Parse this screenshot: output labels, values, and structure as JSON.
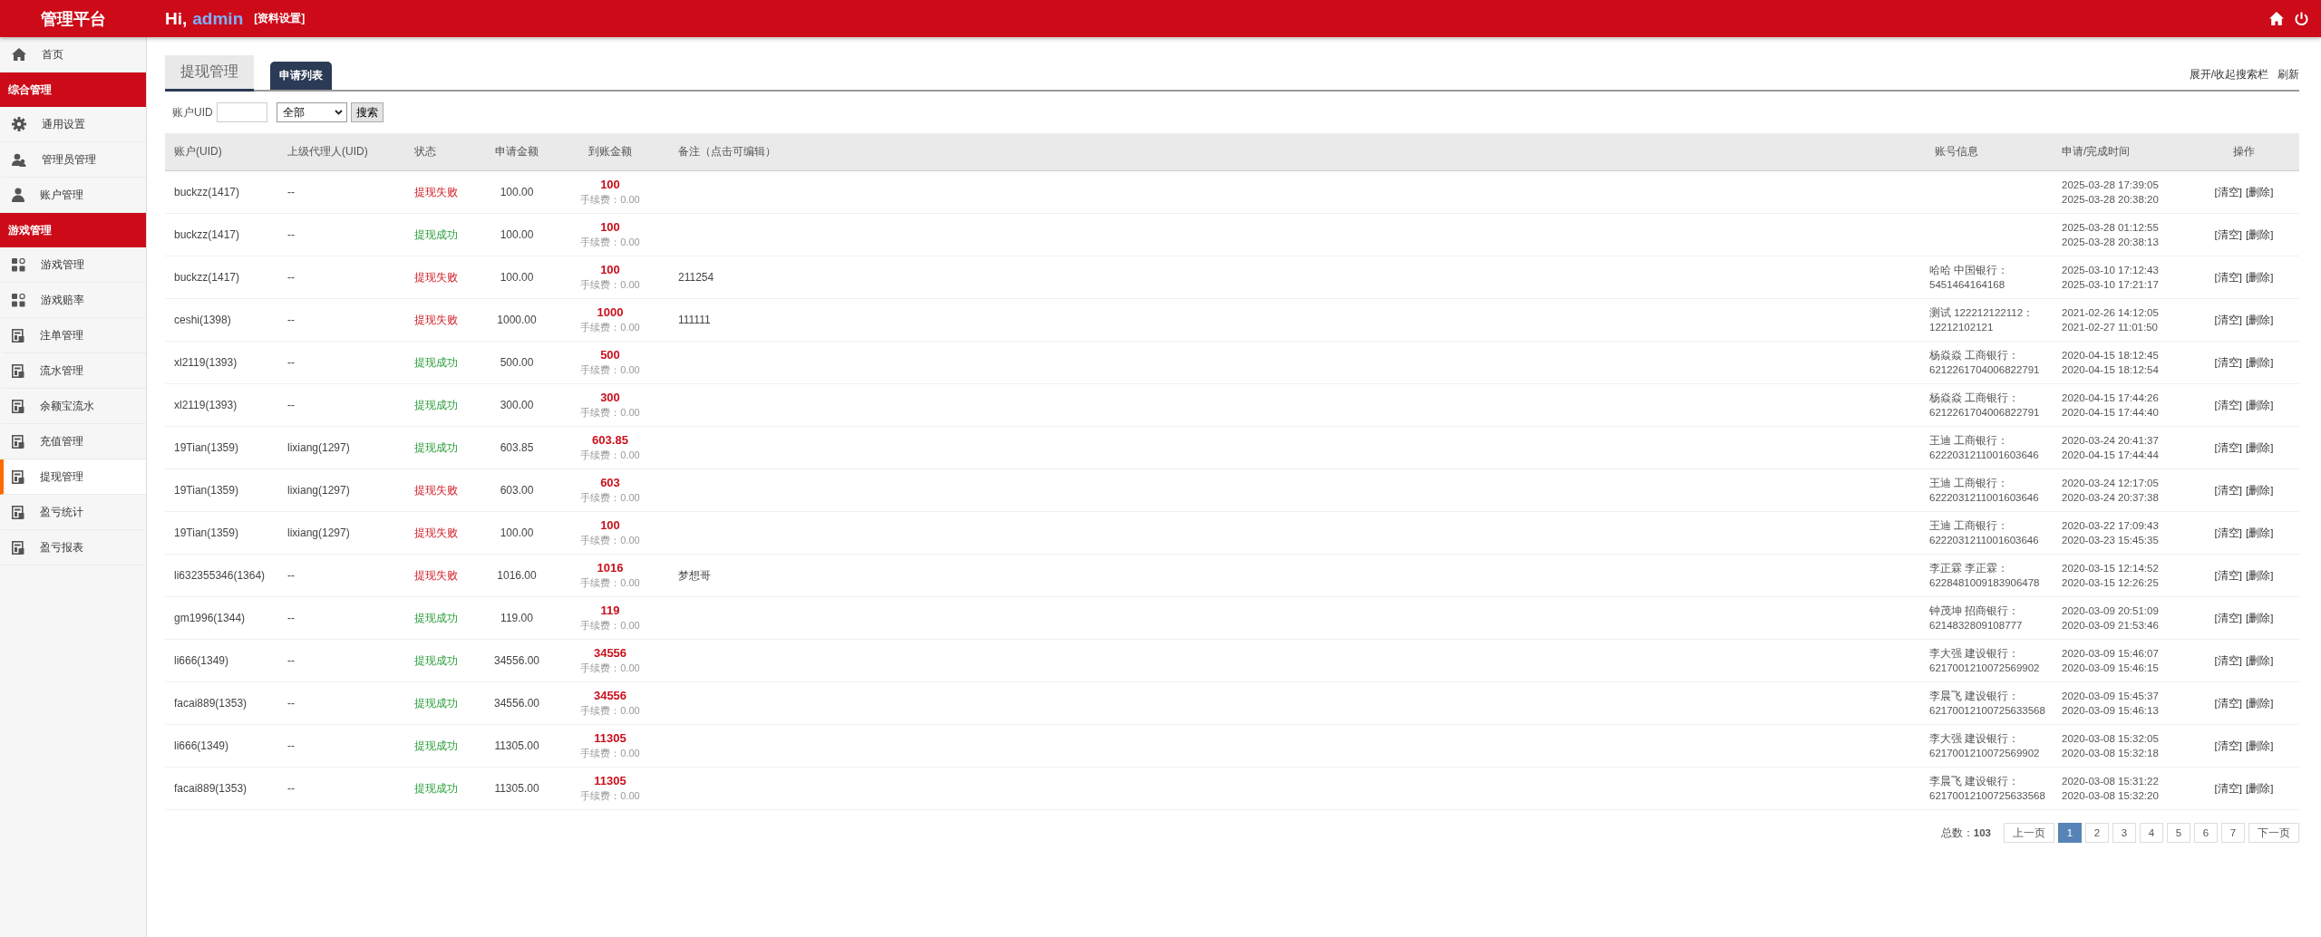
{
  "header": {
    "title": "管理平台",
    "greeting": "Hi,",
    "user": "admin",
    "profile_link": "[资料设置]"
  },
  "sidebar": {
    "items": [
      {
        "kind": "item",
        "label": "首页",
        "selected": false
      },
      {
        "kind": "section",
        "label": "综合管理",
        "selected": false
      },
      {
        "kind": "item",
        "label": "通用设置",
        "selected": false
      },
      {
        "kind": "item",
        "label": "管理员管理",
        "selected": false
      },
      {
        "kind": "item",
        "label": "账户管理",
        "selected": false
      },
      {
        "kind": "section",
        "label": "游戏管理",
        "selected": false
      },
      {
        "kind": "item",
        "label": "游戏管理",
        "selected": false
      },
      {
        "kind": "item",
        "label": "游戏赔率",
        "selected": false
      },
      {
        "kind": "item",
        "label": "注单管理",
        "selected": false
      },
      {
        "kind": "item",
        "label": "流水管理",
        "selected": false
      },
      {
        "kind": "item",
        "label": "余额宝流水",
        "selected": false
      },
      {
        "kind": "item",
        "label": "充值管理",
        "selected": false
      },
      {
        "kind": "item",
        "label": "提现管理",
        "selected": true
      },
      {
        "kind": "item",
        "label": "盈亏统计",
        "selected": false
      },
      {
        "kind": "item",
        "label": "盈亏报表",
        "selected": false
      }
    ]
  },
  "tabs": [
    {
      "label": "提现管理",
      "selected": false
    },
    {
      "label": "申请列表",
      "selected": true
    }
  ],
  "toolbar_links": [
    "展开/收起搜索栏",
    "刷新"
  ],
  "search": {
    "label": "账户UID",
    "select_value": "全部",
    "button": "搜索"
  },
  "table": {
    "columns": [
      "账户(UID)",
      "上级代理人(UID)",
      "状态",
      "申请金额",
      "到账金额",
      "备注（点击可编辑）",
      "账号信息",
      "申请/完成时间",
      "操作"
    ],
    "rows": [
      {
        "account": "buckzz(1417)",
        "agent": "--",
        "status": "提现失败",
        "succeeded": false,
        "amount": "100.00",
        "received": "100",
        "fee": "手续费：0.00",
        "note": "",
        "info": [],
        "times": [
          "2025-03-28 17:39:05",
          "2025-03-28 20:38:20"
        ],
        "actions": [
          "[清空]",
          "[删除]"
        ]
      },
      {
        "account": "buckzz(1417)",
        "agent": "--",
        "status": "提现成功",
        "succeeded": true,
        "amount": "100.00",
        "received": "100",
        "fee": "手续费：0.00",
        "note": "",
        "info": [],
        "times": [
          "2025-03-28 01:12:55",
          "2025-03-28 20:38:13"
        ],
        "actions": [
          "[清空]",
          "[删除]"
        ]
      },
      {
        "account": "buckzz(1417)",
        "agent": "--",
        "status": "提现失败",
        "succeeded": false,
        "amount": "100.00",
        "received": "100",
        "fee": "手续费：0.00",
        "note": "211254",
        "info": [
          "哈哈 中国银行：",
          "5451464164168"
        ],
        "times": [
          "2025-03-10 17:12:43",
          "2025-03-10 17:21:17"
        ],
        "actions": [
          "[清空]",
          "[删除]"
        ]
      },
      {
        "account": "ceshi(1398)",
        "agent": "--",
        "status": "提现失败",
        "succeeded": false,
        "amount": "1000.00",
        "received": "1000",
        "fee": "手续费：0.00",
        "note": "111111",
        "info": [
          "测试 122212122112：",
          "12212102121"
        ],
        "times": [
          "2021-02-26 14:12:05",
          "2021-02-27 11:01:50"
        ],
        "actions": [
          "[清空]",
          "[删除]"
        ]
      },
      {
        "account": "xl2119(1393)",
        "agent": "--",
        "status": "提现成功",
        "succeeded": true,
        "amount": "500.00",
        "received": "500",
        "fee": "手续费：0.00",
        "note": "",
        "info": [
          "杨焱焱 工商银行：",
          "6212261704006822791"
        ],
        "times": [
          "2020-04-15 18:12:45",
          "2020-04-15 18:12:54"
        ],
        "actions": [
          "[清空]",
          "[删除]"
        ]
      },
      {
        "account": "xl2119(1393)",
        "agent": "--",
        "status": "提现成功",
        "succeeded": true,
        "amount": "300.00",
        "received": "300",
        "fee": "手续费：0.00",
        "note": "",
        "info": [
          "杨焱焱 工商银行：",
          "6212261704006822791"
        ],
        "times": [
          "2020-04-15 17:44:26",
          "2020-04-15 17:44:40"
        ],
        "actions": [
          "[清空]",
          "[删除]"
        ]
      },
      {
        "account": "19Tian(1359)",
        "agent": "lixiang(1297)",
        "status": "提现成功",
        "succeeded": true,
        "amount": "603.85",
        "received": "603.85",
        "fee": "手续费：0.00",
        "note": "",
        "info": [
          "王迪 工商银行：",
          "6222031211001603646"
        ],
        "times": [
          "2020-03-24 20:41:37",
          "2020-04-15 17:44:44"
        ],
        "actions": [
          "[清空]",
          "[删除]"
        ]
      },
      {
        "account": "19Tian(1359)",
        "agent": "lixiang(1297)",
        "status": "提现失败",
        "succeeded": false,
        "amount": "603.00",
        "received": "603",
        "fee": "手续费：0.00",
        "note": "",
        "info": [
          "王迪 工商银行：",
          "6222031211001603646"
        ],
        "times": [
          "2020-03-24 12:17:05",
          "2020-03-24 20:37:38"
        ],
        "actions": [
          "[清空]",
          "[删除]"
        ]
      },
      {
        "account": "19Tian(1359)",
        "agent": "lixiang(1297)",
        "status": "提现失败",
        "succeeded": false,
        "amount": "100.00",
        "received": "100",
        "fee": "手续费：0.00",
        "note": "",
        "info": [
          "王迪 工商银行：",
          "6222031211001603646"
        ],
        "times": [
          "2020-03-22 17:09:43",
          "2020-03-23 15:45:35"
        ],
        "actions": [
          "[清空]",
          "[删除]"
        ]
      },
      {
        "account": "li632355346(1364)",
        "agent": "--",
        "status": "提现失败",
        "succeeded": false,
        "amount": "1016.00",
        "received": "1016",
        "fee": "手续费：0.00",
        "note": "梦想哥",
        "info": [
          "李正霖 李正霖：",
          "6228481009183906478"
        ],
        "times": [
          "2020-03-15 12:14:52",
          "2020-03-15 12:26:25"
        ],
        "actions": [
          "[清空]",
          "[删除]"
        ]
      },
      {
        "account": "gm1996(1344)",
        "agent": "--",
        "status": "提现成功",
        "succeeded": true,
        "amount": "119.00",
        "received": "119",
        "fee": "手续费：0.00",
        "note": "",
        "info": [
          "钟茂坤 招商银行：",
          "6214832809108777"
        ],
        "times": [
          "2020-03-09 20:51:09",
          "2020-03-09 21:53:46"
        ],
        "actions": [
          "[清空]",
          "[删除]"
        ]
      },
      {
        "account": "li666(1349)",
        "agent": "--",
        "status": "提现成功",
        "succeeded": true,
        "amount": "34556.00",
        "received": "34556",
        "fee": "手续费：0.00",
        "note": "",
        "info": [
          "李大强 建设银行：",
          "6217001210072569902"
        ],
        "times": [
          "2020-03-09 15:46:07",
          "2020-03-09 15:46:15"
        ],
        "actions": [
          "[清空]",
          "[删除]"
        ]
      },
      {
        "account": "facai889(1353)",
        "agent": "--",
        "status": "提现成功",
        "succeeded": true,
        "amount": "34556.00",
        "received": "34556",
        "fee": "手续费：0.00",
        "note": "",
        "info": [
          "李晨飞 建设银行：",
          "62170012100725633568"
        ],
        "times": [
          "2020-03-09 15:45:37",
          "2020-03-09 15:46:13"
        ],
        "actions": [
          "[清空]",
          "[删除]"
        ]
      },
      {
        "account": "li666(1349)",
        "agent": "--",
        "status": "提现成功",
        "succeeded": true,
        "amount": "11305.00",
        "received": "11305",
        "fee": "手续费：0.00",
        "note": "",
        "info": [
          "李大强 建设银行：",
          "6217001210072569902"
        ],
        "times": [
          "2020-03-08 15:32:05",
          "2020-03-08 15:32:18"
        ],
        "actions": [
          "[清空]",
          "[删除]"
        ]
      },
      {
        "account": "facai889(1353)",
        "agent": "--",
        "status": "提现成功",
        "succeeded": true,
        "amount": "11305.00",
        "received": "11305",
        "fee": "手续费：0.00",
        "note": "",
        "info": [
          "李晨飞 建设银行：",
          "62170012100725633568"
        ],
        "times": [
          "2020-03-08 15:31:22",
          "2020-03-08 15:32:20"
        ],
        "actions": [
          "[清空]",
          "[删除]"
        ]
      }
    ]
  },
  "pagination": {
    "total": "总数：**103**",
    "prev": "上一页",
    "next": "下一页",
    "pages": [
      {
        "label": "1",
        "selected": true
      },
      {
        "label": "2",
        "selected": false
      },
      {
        "label": "3",
        "selected": false
      },
      {
        "label": "4",
        "selected": false
      },
      {
        "label": "5",
        "selected": false
      },
      {
        "label": "6",
        "selected": false
      },
      {
        "label": "7",
        "selected": false
      }
    ]
  }
}
